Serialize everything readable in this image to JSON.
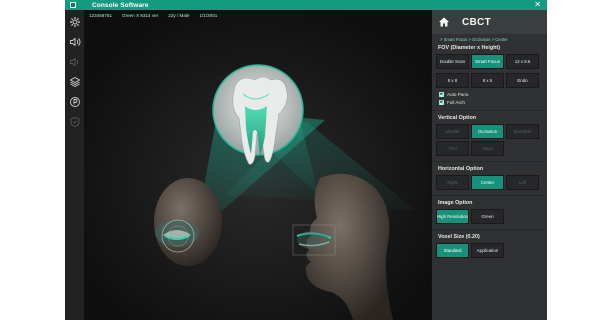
{
  "app": {
    "title": "Console Software",
    "close_glyph": "✕"
  },
  "toolbar": {
    "icons": [
      "gear-icon",
      "speaker-icon",
      "speaker-muted-icon",
      "layers-icon",
      "parking-icon",
      "shield-icon"
    ]
  },
  "patient": {
    "id": "123456751",
    "name": "Green X 8314 ver",
    "age_sex": "22y / Male",
    "dob": "1/1/2001"
  },
  "panel": {
    "title": "CBCT",
    "breadcrumb": "> Smart Focus > Occlusion > Center",
    "fov": {
      "title": "FOV (Diameter x Height)",
      "row1": [
        "Double Scan",
        "Smart Focus",
        "12 x 8.5"
      ],
      "row2": [
        "8 x 8",
        "8 x 5",
        "Endo"
      ],
      "selected": "Smart Focus"
    },
    "checks": [
      "Auto Pano",
      "Full Arch"
    ],
    "vertical": {
      "title": "Vertical Option",
      "options": [
        "Maxilla",
        "Occlusion",
        "Mandible"
      ],
      "row2": [
        "TMJ",
        "Sinus"
      ],
      "selected": "Occlusion"
    },
    "horizontal": {
      "title": "Horizontal Option",
      "options": [
        "Right",
        "Center",
        "Left"
      ],
      "selected": "Center"
    },
    "image": {
      "title": "Image Option",
      "options": [
        "High Resolution",
        "Green"
      ],
      "selected": "High Resolution"
    },
    "voxel": {
      "title": "Voxel Size (0.20)",
      "options": [
        "Standard",
        "Application"
      ],
      "selected": "Standard"
    }
  },
  "colors": {
    "accent": "#17917a",
    "titlebar": "#159a82",
    "panel_bg": "#2f3132",
    "viewport_bg": "#111111"
  }
}
